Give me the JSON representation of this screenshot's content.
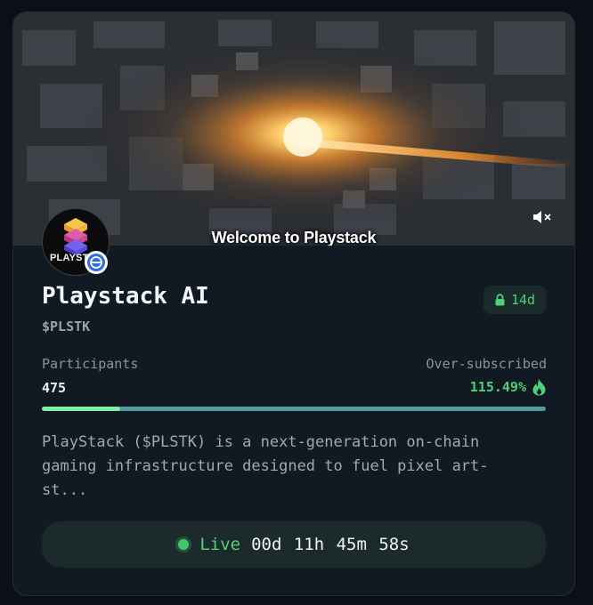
{
  "video": {
    "caption": "Welcome to Playstack",
    "mute_icon": "speaker-muted-icon"
  },
  "project": {
    "name": "Playstack AI",
    "ticker": "$PLSTK",
    "avatar_text": "PLAYSTA",
    "lock_label": "14d"
  },
  "stats": {
    "participants_label": "Participants",
    "participants_value": "475",
    "oversubscribed_label": "Over-subscribed",
    "oversubscribed_value": "115.49%"
  },
  "progress": {
    "fraction": 0.155
  },
  "description": "PlayStack ($PLSTK) is a next-generation on-chain\ngaming infrastructure designed to fuel pixel art-\nst...",
  "live": {
    "label": "Live",
    "countdown": "00d 11h 45m 58s"
  },
  "colors": {
    "accent_green": "#4ed07a",
    "progress_track": "#4e9ba1",
    "progress_fill": "#7ef0a0",
    "chain_blue": "#2f6fe0"
  }
}
